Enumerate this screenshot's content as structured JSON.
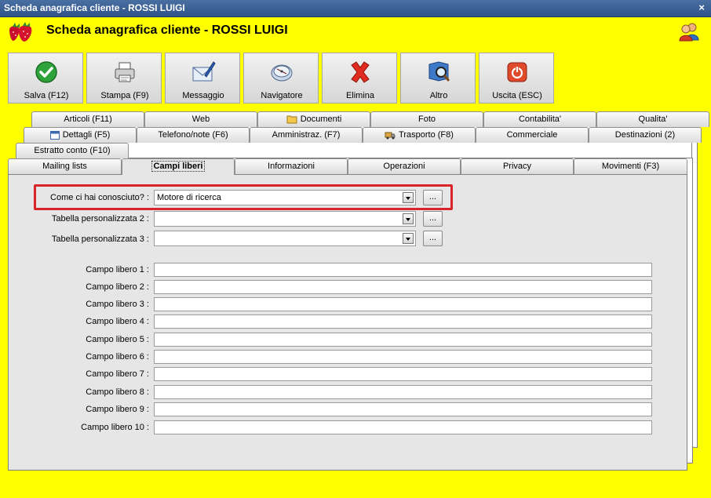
{
  "window": {
    "title": "Scheda anagrafica cliente - ROSSI LUIGI",
    "close_glyph": "×"
  },
  "header": {
    "title": "Scheda anagrafica cliente - ROSSI LUIGI"
  },
  "toolbar": [
    {
      "label": "Salva (F12)",
      "icon": "check-icon"
    },
    {
      "label": "Stampa (F9)",
      "icon": "printer-icon"
    },
    {
      "label": "Messaggio",
      "icon": "mail-icon"
    },
    {
      "label": "Navigatore",
      "icon": "compass-icon"
    },
    {
      "label": "Elimina",
      "icon": "delete-x-icon"
    },
    {
      "label": "Altro",
      "icon": "book-search-icon"
    },
    {
      "label": "Uscita (ESC)",
      "icon": "power-icon"
    }
  ],
  "tabs": {
    "row1": [
      "Articoli (F11)",
      "Web",
      "Documenti",
      "Foto",
      "Contabilita'",
      "Qualita'"
    ],
    "row2": [
      "Dettagli (F5)",
      "Telefono/note (F6)",
      "Amministraz. (F7)",
      "Trasporto (F8)",
      "Commerciale",
      "Destinazioni (2)"
    ],
    "row3": [
      "Estratto conto (F10)"
    ],
    "row4": [
      "Mailing lists",
      "Campi liberi",
      "Informazioni",
      "Operazioni",
      "Privacy",
      "Movimenti (F3)"
    ],
    "active": "Campi liberi"
  },
  "form": {
    "combos": [
      {
        "label": "Come ci hai conosciuto? :",
        "value": "Motore di ricerca",
        "button": "..."
      },
      {
        "label": "Tabella personalizzata 2 :",
        "value": "",
        "button": "..."
      },
      {
        "label": "Tabella personalizzata 3 :",
        "value": "",
        "button": "..."
      }
    ],
    "fields": [
      {
        "label": "Campo libero 1 :",
        "value": ""
      },
      {
        "label": "Campo libero 2 :",
        "value": ""
      },
      {
        "label": "Campo libero 3 :",
        "value": ""
      },
      {
        "label": "Campo libero 4 :",
        "value": ""
      },
      {
        "label": "Campo libero 5 :",
        "value": ""
      },
      {
        "label": "Campo libero 6 :",
        "value": ""
      },
      {
        "label": "Campo libero 7 :",
        "value": ""
      },
      {
        "label": "Campo libero 8 :",
        "value": ""
      },
      {
        "label": "Campo libero 9 :",
        "value": ""
      },
      {
        "label": "Campo libero 10 :",
        "value": ""
      }
    ]
  },
  "colors": {
    "background": "#FFFF00",
    "highlight": "#D9252A",
    "titlebar": "#3B5F94"
  }
}
